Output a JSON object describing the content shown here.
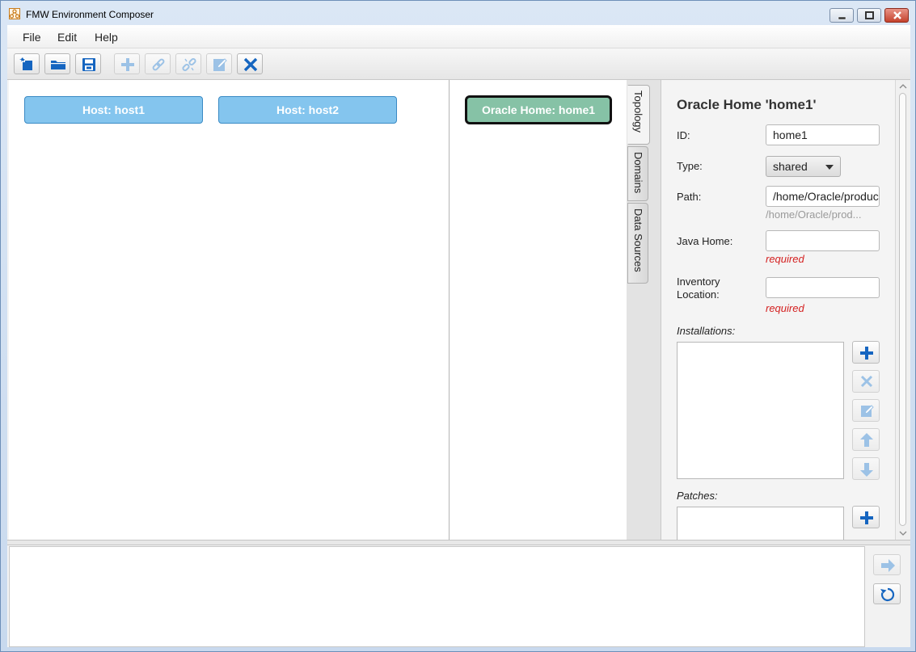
{
  "window": {
    "title": "FMW Environment Composer",
    "app_icon": "graph-icon",
    "controls": [
      "minimize-icon",
      "maximize-icon",
      "close-icon"
    ]
  },
  "menubar": {
    "items": [
      {
        "label": "File"
      },
      {
        "label": "Edit"
      },
      {
        "label": "Help"
      }
    ]
  },
  "toolbar": {
    "buttons": [
      {
        "icon": "new-file-icon",
        "enabled": true
      },
      {
        "icon": "open-folder-icon",
        "enabled": true
      },
      {
        "icon": "save-icon",
        "enabled": true
      },
      {
        "icon": "add-icon",
        "enabled": false
      },
      {
        "icon": "link-icon",
        "enabled": false
      },
      {
        "icon": "unlink-icon",
        "enabled": false
      },
      {
        "icon": "edit-icon",
        "enabled": false
      },
      {
        "icon": "delete-icon",
        "enabled": true
      }
    ]
  },
  "canvas": {
    "hosts": [
      {
        "label": "Host: host1"
      },
      {
        "label": "Host: host2"
      }
    ],
    "selected_node": {
      "label": "Oracle Home: home1"
    }
  },
  "tabs": [
    {
      "label": "Topology",
      "active": true
    },
    {
      "label": "Domains",
      "active": false
    },
    {
      "label": "Data Sources",
      "active": false
    }
  ],
  "properties": {
    "title": "Oracle Home 'home1'",
    "id_label": "ID:",
    "id_value": "home1",
    "type_label": "Type:",
    "type_value": "shared",
    "path_label": "Path:",
    "path_value": "/home/Oracle/products",
    "path_hint": "/home/Oracle/prod...",
    "java_home_label": "Java Home:",
    "java_home_value": "",
    "java_home_error": "required",
    "inventory_label_line1": "Inventory",
    "inventory_label_line2": "Location:",
    "inventory_value": "",
    "inventory_error": "required",
    "installations_label": "Installations:",
    "patches_label": "Patches:"
  },
  "colors": {
    "host_node": "#84c5ee",
    "home_node": "#86c2a6",
    "accent_blue": "#1565c0",
    "error_red": "#d42020"
  }
}
